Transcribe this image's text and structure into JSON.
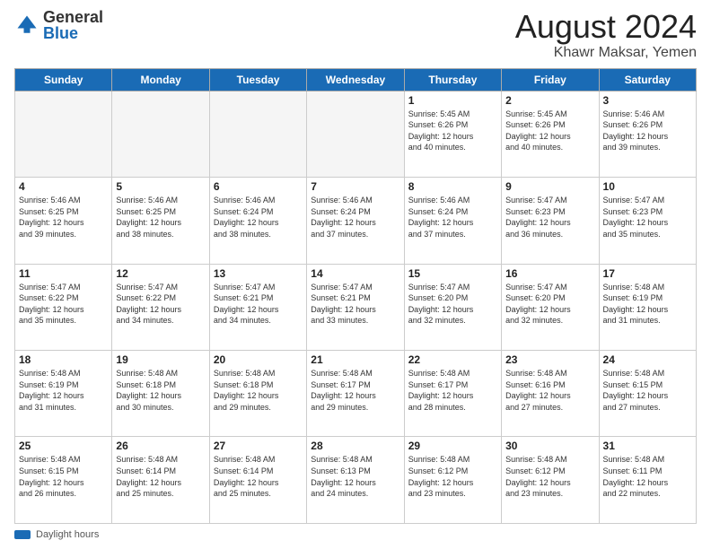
{
  "logo": {
    "general": "General",
    "blue": "Blue"
  },
  "title": {
    "month_year": "August 2024",
    "location": "Khawr Maksar, Yemen"
  },
  "days_of_week": [
    "Sunday",
    "Monday",
    "Tuesday",
    "Wednesday",
    "Thursday",
    "Friday",
    "Saturday"
  ],
  "footer": {
    "label": "Daylight hours"
  },
  "weeks": [
    [
      {
        "day": "",
        "info": ""
      },
      {
        "day": "",
        "info": ""
      },
      {
        "day": "",
        "info": ""
      },
      {
        "day": "",
        "info": ""
      },
      {
        "day": "1",
        "info": "Sunrise: 5:45 AM\nSunset: 6:26 PM\nDaylight: 12 hours\nand 40 minutes."
      },
      {
        "day": "2",
        "info": "Sunrise: 5:45 AM\nSunset: 6:26 PM\nDaylight: 12 hours\nand 40 minutes."
      },
      {
        "day": "3",
        "info": "Sunrise: 5:46 AM\nSunset: 6:26 PM\nDaylight: 12 hours\nand 39 minutes."
      }
    ],
    [
      {
        "day": "4",
        "info": "Sunrise: 5:46 AM\nSunset: 6:25 PM\nDaylight: 12 hours\nand 39 minutes."
      },
      {
        "day": "5",
        "info": "Sunrise: 5:46 AM\nSunset: 6:25 PM\nDaylight: 12 hours\nand 38 minutes."
      },
      {
        "day": "6",
        "info": "Sunrise: 5:46 AM\nSunset: 6:24 PM\nDaylight: 12 hours\nand 38 minutes."
      },
      {
        "day": "7",
        "info": "Sunrise: 5:46 AM\nSunset: 6:24 PM\nDaylight: 12 hours\nand 37 minutes."
      },
      {
        "day": "8",
        "info": "Sunrise: 5:46 AM\nSunset: 6:24 PM\nDaylight: 12 hours\nand 37 minutes."
      },
      {
        "day": "9",
        "info": "Sunrise: 5:47 AM\nSunset: 6:23 PM\nDaylight: 12 hours\nand 36 minutes."
      },
      {
        "day": "10",
        "info": "Sunrise: 5:47 AM\nSunset: 6:23 PM\nDaylight: 12 hours\nand 35 minutes."
      }
    ],
    [
      {
        "day": "11",
        "info": "Sunrise: 5:47 AM\nSunset: 6:22 PM\nDaylight: 12 hours\nand 35 minutes."
      },
      {
        "day": "12",
        "info": "Sunrise: 5:47 AM\nSunset: 6:22 PM\nDaylight: 12 hours\nand 34 minutes."
      },
      {
        "day": "13",
        "info": "Sunrise: 5:47 AM\nSunset: 6:21 PM\nDaylight: 12 hours\nand 34 minutes."
      },
      {
        "day": "14",
        "info": "Sunrise: 5:47 AM\nSunset: 6:21 PM\nDaylight: 12 hours\nand 33 minutes."
      },
      {
        "day": "15",
        "info": "Sunrise: 5:47 AM\nSunset: 6:20 PM\nDaylight: 12 hours\nand 32 minutes."
      },
      {
        "day": "16",
        "info": "Sunrise: 5:47 AM\nSunset: 6:20 PM\nDaylight: 12 hours\nand 32 minutes."
      },
      {
        "day": "17",
        "info": "Sunrise: 5:48 AM\nSunset: 6:19 PM\nDaylight: 12 hours\nand 31 minutes."
      }
    ],
    [
      {
        "day": "18",
        "info": "Sunrise: 5:48 AM\nSunset: 6:19 PM\nDaylight: 12 hours\nand 31 minutes."
      },
      {
        "day": "19",
        "info": "Sunrise: 5:48 AM\nSunset: 6:18 PM\nDaylight: 12 hours\nand 30 minutes."
      },
      {
        "day": "20",
        "info": "Sunrise: 5:48 AM\nSunset: 6:18 PM\nDaylight: 12 hours\nand 29 minutes."
      },
      {
        "day": "21",
        "info": "Sunrise: 5:48 AM\nSunset: 6:17 PM\nDaylight: 12 hours\nand 29 minutes."
      },
      {
        "day": "22",
        "info": "Sunrise: 5:48 AM\nSunset: 6:17 PM\nDaylight: 12 hours\nand 28 minutes."
      },
      {
        "day": "23",
        "info": "Sunrise: 5:48 AM\nSunset: 6:16 PM\nDaylight: 12 hours\nand 27 minutes."
      },
      {
        "day": "24",
        "info": "Sunrise: 5:48 AM\nSunset: 6:15 PM\nDaylight: 12 hours\nand 27 minutes."
      }
    ],
    [
      {
        "day": "25",
        "info": "Sunrise: 5:48 AM\nSunset: 6:15 PM\nDaylight: 12 hours\nand 26 minutes."
      },
      {
        "day": "26",
        "info": "Sunrise: 5:48 AM\nSunset: 6:14 PM\nDaylight: 12 hours\nand 25 minutes."
      },
      {
        "day": "27",
        "info": "Sunrise: 5:48 AM\nSunset: 6:14 PM\nDaylight: 12 hours\nand 25 minutes."
      },
      {
        "day": "28",
        "info": "Sunrise: 5:48 AM\nSunset: 6:13 PM\nDaylight: 12 hours\nand 24 minutes."
      },
      {
        "day": "29",
        "info": "Sunrise: 5:48 AM\nSunset: 6:12 PM\nDaylight: 12 hours\nand 23 minutes."
      },
      {
        "day": "30",
        "info": "Sunrise: 5:48 AM\nSunset: 6:12 PM\nDaylight: 12 hours\nand 23 minutes."
      },
      {
        "day": "31",
        "info": "Sunrise: 5:48 AM\nSunset: 6:11 PM\nDaylight: 12 hours\nand 22 minutes."
      }
    ]
  ]
}
